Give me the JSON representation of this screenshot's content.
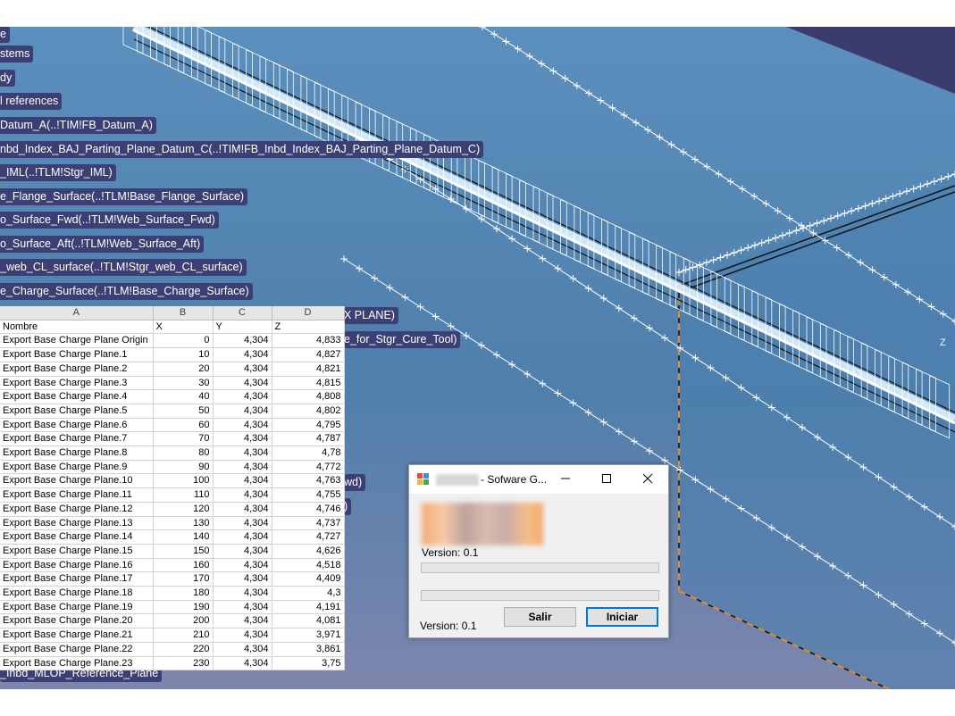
{
  "tree_labels": [
    "e",
    "stems",
    "dy",
    "l references",
    "Datum_A(..!TIM!FB_Datum_A)",
    "nbd_Index_BAJ_Parting_Plane_Datum_C(..!TIM!FB_Inbd_Index_BAJ_Parting_Plane_Datum_C)",
    "_IML(..!TLM!Stgr_IML)",
    "e_Flange_Surface(..!TLM!Base_Flange_Surface)",
    "o_Surface_Fwd(..!TLM!Web_Surface_Fwd)",
    "o_Surface_Aft(..!TLM!Web_Surface_Aft)",
    "_web_CL_surface(..!TLM!Stgr_web_CL_surface)",
    "e_Charge_Surface(..!TLM!Base_Charge_Surface)"
  ],
  "tree_partial_labels": [
    "X PLANE)",
    "e_for_Stgr_Cure_Tool)",
    "wd)",
    ")",
    "_Inbd_MLOP_Reference_Plane"
  ],
  "axis_label": "Z",
  "spreadsheet": {
    "column_letters": [
      "A",
      "B",
      "C",
      "D"
    ],
    "headers": [
      "Nombre",
      "X",
      "Y",
      "Z"
    ],
    "rows": [
      [
        "Export Base Charge Plane Origin",
        "0",
        "4,304",
        "4,833"
      ],
      [
        "Export Base Charge Plane.1",
        "10",
        "4,304",
        "4,827"
      ],
      [
        "Export Base Charge Plane.2",
        "20",
        "4,304",
        "4,821"
      ],
      [
        "Export Base Charge Plane.3",
        "30",
        "4,304",
        "4,815"
      ],
      [
        "Export Base Charge Plane.4",
        "40",
        "4,304",
        "4,808"
      ],
      [
        "Export Base Charge Plane.5",
        "50",
        "4,304",
        "4,802"
      ],
      [
        "Export Base Charge Plane.6",
        "60",
        "4,304",
        "4,795"
      ],
      [
        "Export Base Charge Plane.7",
        "70",
        "4,304",
        "4,787"
      ],
      [
        "Export Base Charge Plane.8",
        "80",
        "4,304",
        "4,78"
      ],
      [
        "Export Base Charge Plane.9",
        "90",
        "4,304",
        "4,772"
      ],
      [
        "Export Base Charge Plane.10",
        "100",
        "4,304",
        "4,763"
      ],
      [
        "Export Base Charge Plane.11",
        "110",
        "4,304",
        "4,755"
      ],
      [
        "Export Base Charge Plane.12",
        "120",
        "4,304",
        "4,746"
      ],
      [
        "Export Base Charge Plane.13",
        "130",
        "4,304",
        "4,737"
      ],
      [
        "Export Base Charge Plane.14",
        "140",
        "4,304",
        "4,727"
      ],
      [
        "Export Base Charge Plane.15",
        "150",
        "4,304",
        "4,626"
      ],
      [
        "Export Base Charge Plane.16",
        "160",
        "4,304",
        "4,518"
      ],
      [
        "Export Base Charge Plane.17",
        "170",
        "4,304",
        "4,409"
      ],
      [
        "Export Base Charge Plane.18",
        "180",
        "4,304",
        "4,3"
      ],
      [
        "Export Base Charge Plane.19",
        "190",
        "4,304",
        "4,191"
      ],
      [
        "Export Base Charge Plane.20",
        "200",
        "4,304",
        "4,081"
      ],
      [
        "Export Base Charge Plane.21",
        "210",
        "4,304",
        "3,971"
      ],
      [
        "Export Base Charge Plane.22",
        "220",
        "4,304",
        "3,861"
      ],
      [
        "Export Base Charge Plane.23",
        "230",
        "4,304",
        "3,75"
      ]
    ]
  },
  "dialog": {
    "title": "- Sofware G...",
    "icons": {
      "app": "app-window-icon",
      "minimize": "minimize-icon",
      "maximize": "maximize-icon",
      "close": "close-icon"
    },
    "version_top": "Version: 0.1",
    "version_bottom": "Version: 0.1",
    "progress_top": 0,
    "progress_bottom": 0,
    "exit_label": "Salir",
    "start_label": "Iniciar"
  },
  "colors": {
    "label_bg": "#3c3f73",
    "accent_blue": "#0078d7",
    "orange_edge": "#e08a2c"
  }
}
